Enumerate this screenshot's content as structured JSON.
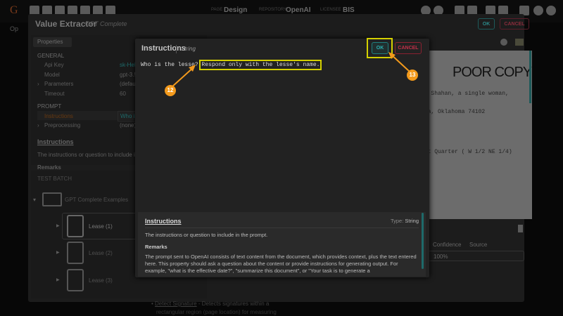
{
  "topbar": {
    "page_label": "PAGE",
    "page": "Design",
    "repo_label": "REPOSITORY",
    "repo": "OpenAI",
    "license_label": "LICENSEE",
    "license": "BIS"
  },
  "tree": {
    "root": "Op"
  },
  "value_extractor": {
    "title": "Value Extractor",
    "subtitle": "GPT Complete",
    "ok": "OK",
    "cancel": "CANCEL"
  },
  "properties": {
    "tab": "Properties",
    "general": "GENERAL",
    "rows": [
      {
        "label": "Api Key",
        "value": "sk-Hel"
      },
      {
        "label": "Model",
        "value": "gpt-3.5"
      },
      {
        "label": "Parameters",
        "value": "(defau"
      },
      {
        "label": "Timeout",
        "value": "60"
      }
    ],
    "prompt": "PROMPT",
    "prompt_rows": [
      {
        "label": "Instructions",
        "value": "Who is"
      },
      {
        "label": "Preprocessing",
        "value": "(none)"
      }
    ],
    "help_title": "Instructions",
    "help_text": "The instructions or question to include in",
    "remarks": "Remarks"
  },
  "test_batch": {
    "title": "TEST BATCH",
    "folder": "GPT Complete Examples",
    "items": [
      "Lease (1)",
      "Lease (2)",
      "Lease (3)"
    ]
  },
  "document": {
    "lines": [
      "POOR COPY",
      "na Shahan, a single woman,",
      "lsa, Oklahoma 74102",
      "ast Quarter ( W 1/2 NE 1/4)"
    ]
  },
  "results": {
    "headers": [
      "Confidence",
      "Source"
    ],
    "confidence": "100%"
  },
  "footer": {
    "link": "Detect Signature",
    "text": " - Detects signatures within a",
    "text2": "rectangular region (page location) for measuring"
  },
  "dialog": {
    "title": "Instructions",
    "type": "String",
    "text_plain": "Who is the lesse? ",
    "text_highlight": "Respond only with the lesse's name.",
    "ok": "OK",
    "cancel": "CANCEL",
    "help": {
      "title": "Instructions",
      "type_label": "Type:",
      "type_value": "String",
      "description": "The instructions or question to include in the prompt.",
      "remarks_title": "Remarks",
      "remarks": "The prompt sent to OpenAI consists of text content from the document, which provides context, plus the text entered here. This property should ask a question about the content or provide instructions for generating output. For example, \"what is the effective date?\", \"summarize this document\", or \"Your task is to generate a"
    }
  },
  "callouts": [
    "12",
    "13"
  ]
}
